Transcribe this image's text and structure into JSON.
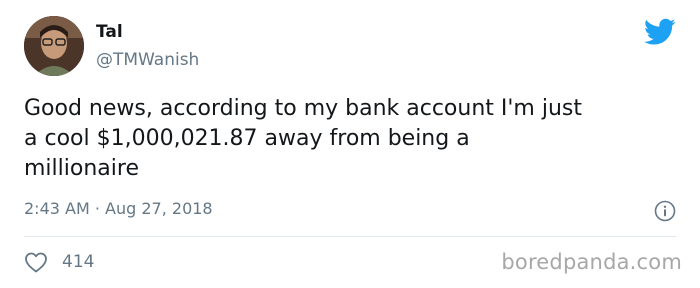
{
  "author": {
    "display_name": "Tal",
    "handle": "@TMWanish"
  },
  "tweet": {
    "text": "Good news, according to my bank account I'm just\na cool $1,000,021.87 away from being a\nmillionaire",
    "timestamp": "2:43 AM · Aug 27, 2018"
  },
  "stats": {
    "likes": "414"
  },
  "watermark": "boredpanda.com",
  "icons": {
    "brand": "twitter-bird-icon",
    "info": "info-icon",
    "like": "heart-icon"
  },
  "colors": {
    "twitter_blue": "#1da1f2",
    "secondary_text": "#657786",
    "primary_text": "#14171a"
  }
}
